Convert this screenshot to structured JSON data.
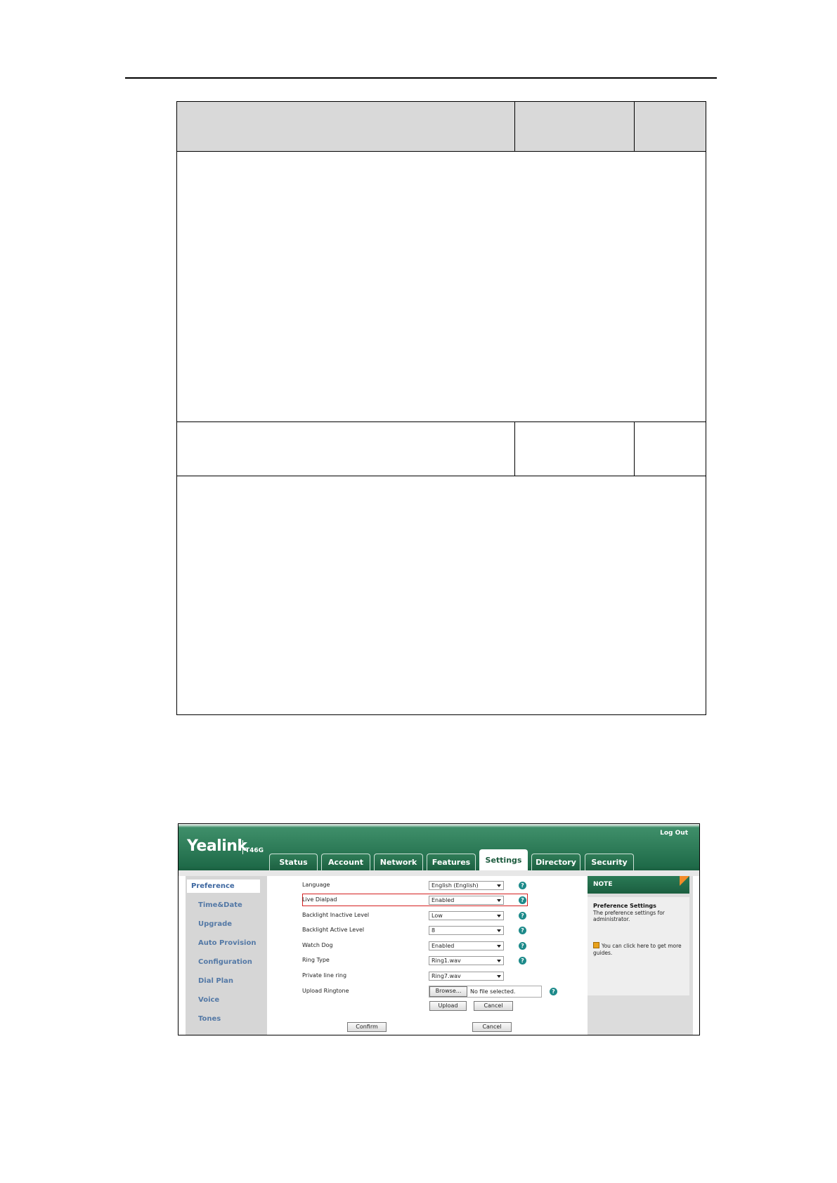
{
  "screenshot": {
    "brand": "Yealink",
    "model": "T46G",
    "logout": "Log Out",
    "tabs": [
      "Status",
      "Account",
      "Network",
      "Features",
      "Settings",
      "Directory",
      "Security"
    ],
    "active_tab": "Settings",
    "sidebar": [
      "Preference",
      "Time&Date",
      "Upgrade",
      "Auto Provision",
      "Configuration",
      "Dial Plan",
      "Voice",
      "Tones"
    ],
    "active_sidebar": "Preference",
    "fields": [
      {
        "label": "Language",
        "value": "English (English)"
      },
      {
        "label": "Live Dialpad",
        "value": "Enabled"
      },
      {
        "label": "Backlight Inactive Level",
        "value": "Low"
      },
      {
        "label": "Backlight Active Level",
        "value": "8"
      },
      {
        "label": "Watch Dog",
        "value": "Enabled"
      },
      {
        "label": "Ring Type",
        "value": "Ring1.wav"
      },
      {
        "label": "Private line ring",
        "value": "Ring7.wav"
      }
    ],
    "upload": {
      "label": "Upload Ringtone",
      "browse": "Browse...",
      "file_status": "No file selected.",
      "upload_btn": "Upload",
      "cancel_btn": "Cancel"
    },
    "confirm": "Confirm",
    "cancel": "Cancel",
    "note": {
      "header": "NOTE",
      "title": "Preference Settings",
      "text": "The preference settings for administrator.",
      "hint": "You can click here to get more guides."
    },
    "colors": {
      "header_green": "#1f6b49",
      "accent_orange": "#f28c28",
      "highlight_red": "#d42020",
      "help_teal": "#1d8a8a",
      "link_blue": "#5479a6"
    }
  }
}
